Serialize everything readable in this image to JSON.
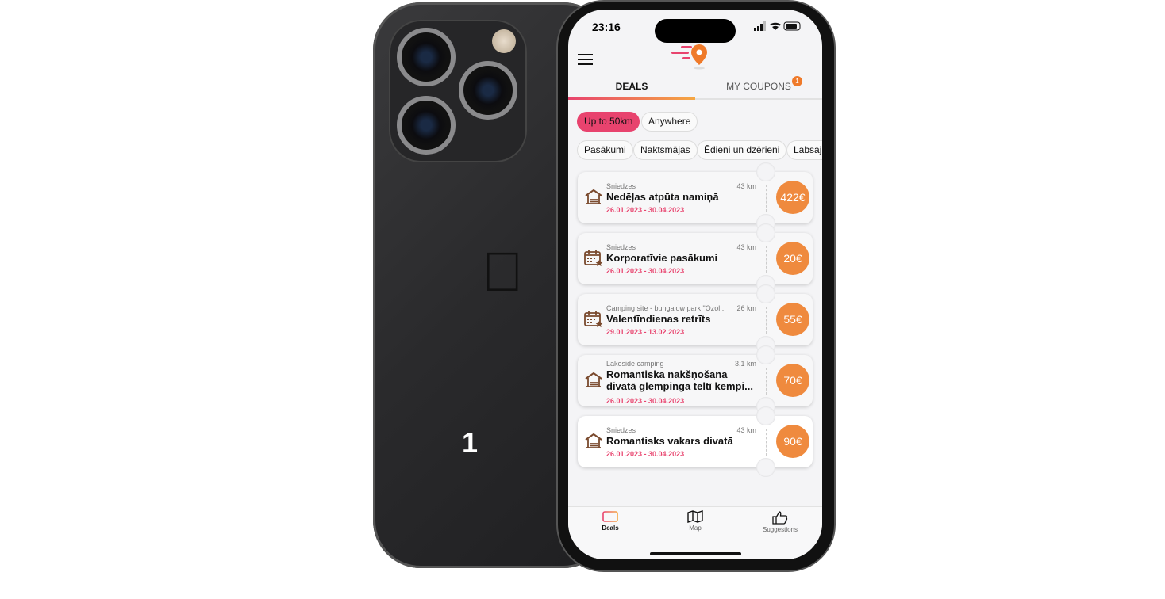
{
  "back": {
    "label": "1"
  },
  "status": {
    "time": "23:16"
  },
  "tabs": {
    "deals": "DEALS",
    "coupons": "MY COUPONS",
    "coupons_badge": "1"
  },
  "filters": [
    "Up to 50km",
    "Anywhere"
  ],
  "categories": [
    "Pasākumi",
    "Naktsmājas",
    "Ēdieni un dzērieni",
    "Labsaj"
  ],
  "deals": [
    {
      "location": "Sniedzes",
      "distance": "43 km",
      "title": "Nedēļas atpūta namiņā",
      "dates": "26.01.2023 - 30.04.2023",
      "price": "422€",
      "icon": "house-icon"
    },
    {
      "location": "Sniedzes",
      "distance": "43 km",
      "title": "Korporatīvie pasākumi",
      "dates": "26.01.2023 - 30.04.2023",
      "price": "20€",
      "icon": "calendar-star-icon"
    },
    {
      "location": "Camping site - bungalow park \"Ozol...",
      "distance": "26 km",
      "title": "Valentīndienas retrīts",
      "dates": "29.01.2023 - 13.02.2023",
      "price": "55€",
      "icon": "calendar-star-icon"
    },
    {
      "location": "Lakeside camping",
      "distance": "3.1 km",
      "title": "Romantiska nakšņošana divatā glempinga teltī kempi...",
      "dates": "26.01.2023 - 30.04.2023",
      "price": "70€",
      "icon": "house-icon"
    },
    {
      "location": "Sniedzes",
      "distance": "43 km",
      "title": "Romantisks vakars divatā",
      "dates": "26.01.2023 - 30.04.2023",
      "price": "90€",
      "icon": "house-icon"
    }
  ],
  "bottom_nav": {
    "deals": "Deals",
    "map": "Map",
    "suggestions": "Suggestions"
  },
  "colors": {
    "accent": "#e8436e",
    "price": "#ef8a3e"
  }
}
